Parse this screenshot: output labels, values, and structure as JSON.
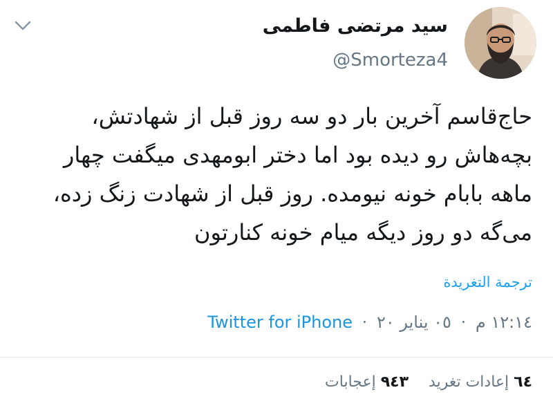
{
  "user": {
    "display_name": "سید مرتضی فاطمی",
    "handle": "@Smorteza4",
    "avatar_icon": "user-avatar"
  },
  "tweet": {
    "text": "حاج‌قاسم آخرین بار دو سه روز قبل از شهادتش، بچه‌هاش رو دیده بود اما دختر ابومهدی میگفت چهار ماهه بابام خونه نیومده. روز قبل از شهادت زنگ زده، می‌گه دو روز دیگه میام خونه کنارتون",
    "translate_label": "ترجمة التغريدة"
  },
  "meta": {
    "time": "١٢:١٤ م",
    "date": "٠٥ يناير ٢٠",
    "separator": "·",
    "source": "Twitter for iPhone"
  },
  "stats": {
    "retweets_count": "٦٤",
    "retweets_label": "إعادات تغريد",
    "likes_count": "٩٤٣",
    "likes_label": "إعجابات"
  },
  "colors": {
    "link": "#1da1f2",
    "secondary_text": "#657786",
    "primary_text": "#14171a",
    "divider": "#e1e8ed"
  },
  "icons": {
    "menu": "chevron-down-icon"
  }
}
